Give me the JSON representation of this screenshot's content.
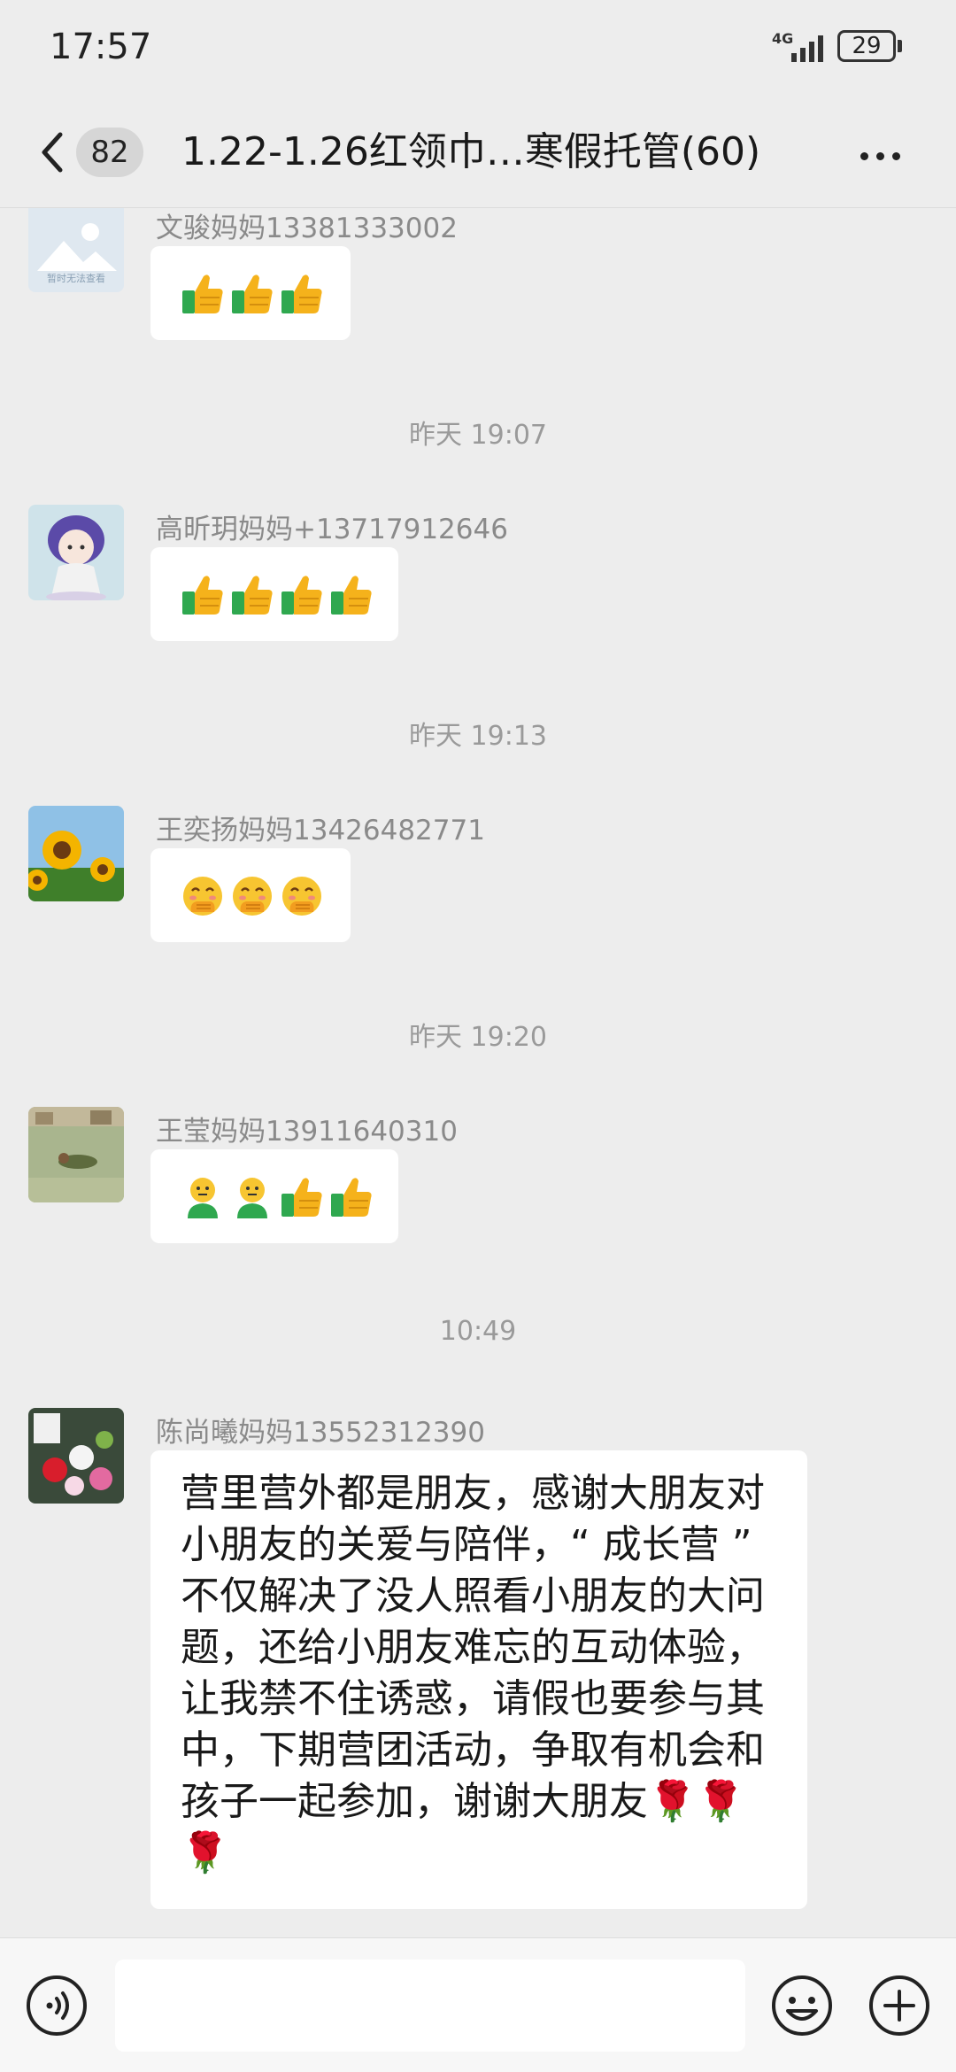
{
  "status_bar": {
    "time": "17:57",
    "network": "4G",
    "battery": "29"
  },
  "header": {
    "unread_count": "82",
    "title": "1.22-1.26红领巾…寒假托管(60)"
  },
  "messages": [
    {
      "type": "emoji",
      "sender": "文骏妈妈13381333002",
      "avatar_caption": "暂时无法查看",
      "emojis": [
        "thumbs-up",
        "thumbs-up",
        "thumbs-up"
      ]
    },
    {
      "type": "timestamp",
      "text": "昨天 19:07"
    },
    {
      "type": "emoji",
      "sender": "高昕玥妈妈+13717912646",
      "emojis": [
        "thumbs-up",
        "thumbs-up",
        "thumbs-up",
        "thumbs-up"
      ]
    },
    {
      "type": "timestamp",
      "text": "昨天 19:13"
    },
    {
      "type": "emoji",
      "sender": "王奕扬妈妈13426482771",
      "emojis": [
        "hand-over-mouth-face",
        "hand-over-mouth-face",
        "hand-over-mouth-face"
      ]
    },
    {
      "type": "timestamp",
      "text": "昨天 19:20"
    },
    {
      "type": "emoji",
      "sender": "王莹妈妈13911640310",
      "emojis": [
        "wechat-smile-person",
        "wechat-smile-person",
        "thumbs-up",
        "thumbs-up"
      ]
    },
    {
      "type": "timestamp",
      "text": "10:49"
    },
    {
      "type": "text",
      "sender": "陈尚曦妈妈13552312390",
      "lines": [
        "营里营外都是朋友，感谢大朋友对",
        "小朋友的关爱与陪伴，“ 成长营 ”",
        "不仅解决了没人照看小朋友的大问",
        "题，还给小朋友难忘的互动体验，",
        "让我禁不住诱惑，请假也要参与其",
        "中，下期营团活动，争取有机会和",
        "孩子一起参加，谢谢大朋友🌹🌹",
        "🌹"
      ]
    }
  ],
  "input_bar": {
    "placeholder": ""
  },
  "colors": {
    "background": "#ededed",
    "bubble": "#ffffff",
    "thumbs_up_yellow": "#f5b21b",
    "thumbs_up_cuff": "#2fa84f",
    "rose_red": "#d81e2c"
  }
}
